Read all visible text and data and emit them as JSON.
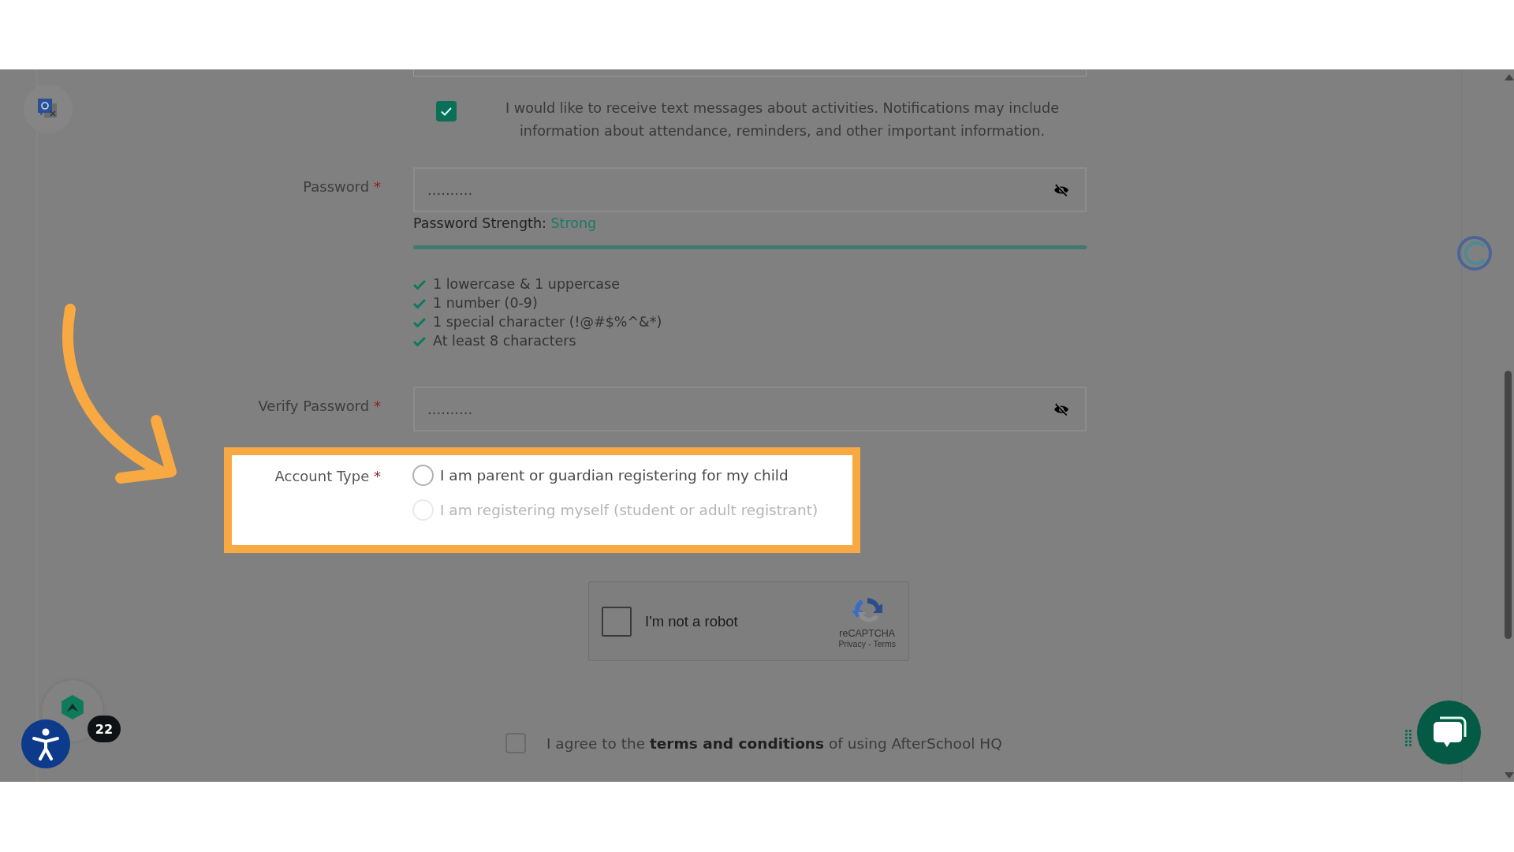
{
  "sms_opt_in": {
    "checked": true,
    "text": "I would like to receive text messages about activities. Notifications may include information about attendance, reminders, and other important information."
  },
  "password": {
    "label": "Password",
    "required_mark": "*",
    "value": "..........",
    "strength_label": "Password Strength:",
    "strength": "Strong",
    "level": 1
  },
  "requirements": [
    {
      "text": "1 lowercase & 1 uppercase",
      "met": true
    },
    {
      "text": "1 number (0-9)",
      "met": true
    },
    {
      "text": "1 special character (!@#$%^&*)",
      "met": true
    },
    {
      "text": "At least 8 characters",
      "met": true
    }
  ],
  "verify_password": {
    "label": "Verify Password",
    "required_mark": "*",
    "value": ".........."
  },
  "account_type": {
    "label": "Account Type",
    "required_mark": "*",
    "options": [
      {
        "label": "I am parent or guardian registering for my child",
        "selected": false,
        "disabled": false
      },
      {
        "label": "I am registering myself (student or adult registrant)",
        "selected": false,
        "disabled": true
      }
    ]
  },
  "captcha": {
    "checked": false,
    "label": "I'm not a robot",
    "brand": "reCAPTCHA",
    "privacy_link": "Privacy",
    "separator": "-",
    "terms_link": "Terms"
  },
  "terms": {
    "checked": false,
    "text": "I agree to the **terms and conditions** of using AfterSchool HQ"
  },
  "notification_badge": "22"
}
